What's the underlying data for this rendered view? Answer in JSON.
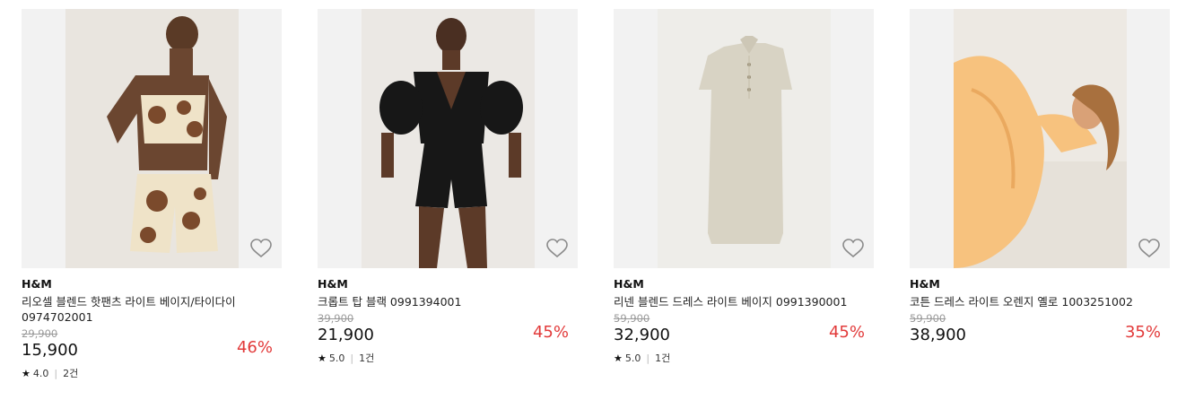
{
  "products": [
    {
      "brand": "H&M",
      "title": "리오셀 블렌드 핫팬츠 라이트 베이지/타이다이 0974702001",
      "original_price": "29,900",
      "price": "15,900",
      "discount": "46%",
      "rating": "4.0",
      "review_count": "2건",
      "photo_bg": "#e6e2dc"
    },
    {
      "brand": "H&M",
      "title": "크롭트 탑 블랙 0991394001",
      "original_price": "39,900",
      "price": "21,900",
      "discount": "45%",
      "rating": "5.0",
      "review_count": "1건",
      "photo_bg": "#e9e6e2"
    },
    {
      "brand": "H&M",
      "title": "리넨 블렌드 드레스 라이트 베이지 0991390001",
      "original_price": "59,900",
      "price": "32,900",
      "discount": "45%",
      "rating": "5.0",
      "review_count": "1건",
      "photo_bg": "#ecebe8"
    },
    {
      "brand": "H&M",
      "title": "코튼 드레스 라이트 오렌지 옐로 1003251002",
      "original_price": "59,900",
      "price": "38,900",
      "discount": "35%",
      "photo_bg": "#ece8e2"
    }
  ],
  "icons": {
    "wishlist": "heart-outline-icon",
    "rating": "star-icon"
  },
  "colors": {
    "discount": "#e23a3a",
    "strike": "#9a9a9a"
  }
}
